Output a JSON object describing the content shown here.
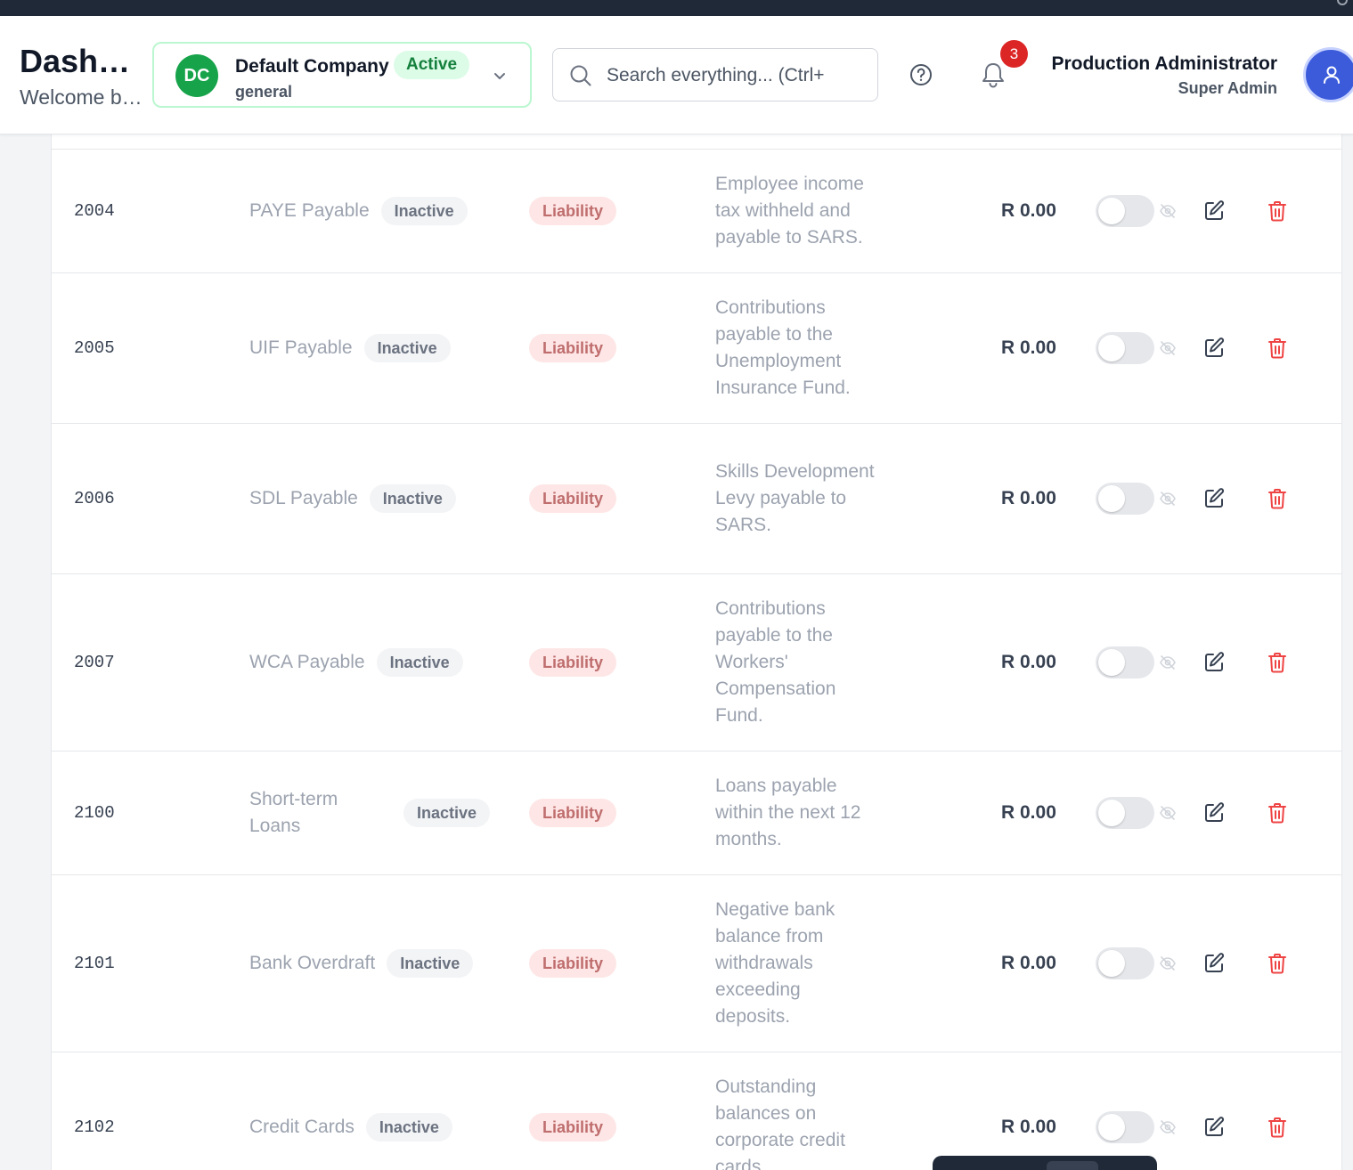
{
  "header": {
    "title": "Dashboard",
    "subtitle": "Welcome back",
    "company": {
      "initials": "DC",
      "name": "Default Company",
      "status": "Active",
      "code": "general"
    },
    "search": {
      "placeholder": "Search everything... (Ctrl+K)"
    },
    "notifications": {
      "count": "3"
    },
    "user": {
      "name": "Production Administrator",
      "role": "Super Admin"
    }
  },
  "table": {
    "rows": [
      {
        "code": "2004",
        "name": "PAYE Payable",
        "status": "Inactive",
        "type": "Liability",
        "description": "Employee income tax withheld and payable to SARS.",
        "balance": "R 0.00"
      },
      {
        "code": "2005",
        "name": "UIF Payable",
        "status": "Inactive",
        "type": "Liability",
        "description": "Contributions payable to the Unemployment Insurance Fund.",
        "balance": "R 0.00"
      },
      {
        "code": "2006",
        "name": "SDL Payable",
        "status": "Inactive",
        "type": "Liability",
        "description": "Skills Development Levy payable to SARS.",
        "balance": "R 0.00"
      },
      {
        "code": "2007",
        "name": "WCA Payable",
        "status": "Inactive",
        "type": "Liability",
        "description": "Contributions payable to the Workers' Compensation Fund.",
        "balance": "R 0.00"
      },
      {
        "code": "2100",
        "name": "Short-term Loans",
        "status": "Inactive",
        "type": "Liability",
        "description": "Loans payable within the next 12 months.",
        "balance": "R 0.00"
      },
      {
        "code": "2101",
        "name": "Bank Overdraft",
        "status": "Inactive",
        "type": "Liability",
        "description": "Negative bank balance from withdrawals exceeding deposits.",
        "balance": "R 0.00"
      },
      {
        "code": "2102",
        "name": "Credit Cards",
        "status": "Inactive",
        "type": "Liability",
        "description": "Outstanding balances on corporate credit cards.",
        "balance": "R 0.00"
      }
    ]
  },
  "icons": {
    "help": "help-circle-icon",
    "bell": "bell-icon",
    "toggle_state": "eye-off-icon",
    "edit": "edit-icon",
    "delete": "trash-icon"
  },
  "colors": {
    "brand_green": "#16a34a",
    "accent_blue": "#3b5bdb",
    "liability": "#b45454",
    "danger": "#ef4444"
  }
}
